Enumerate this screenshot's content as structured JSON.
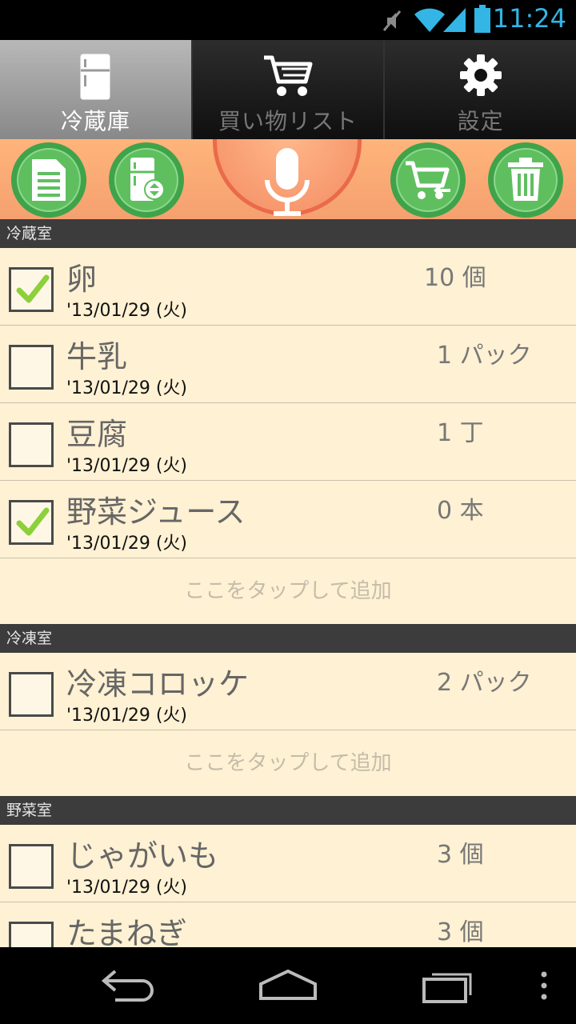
{
  "status_bar": {
    "time": "11:24",
    "icons": [
      "mute-icon",
      "wifi-icon",
      "signal-icon",
      "battery-icon"
    ]
  },
  "tabs": [
    {
      "label": "冷蔵庫",
      "icon": "fridge-icon",
      "active": true
    },
    {
      "label": "買い物リスト",
      "icon": "cart-icon",
      "active": false
    },
    {
      "label": "設定",
      "icon": "gear-icon",
      "active": false
    }
  ],
  "toolbar": {
    "buttons": [
      "document-icon",
      "fridge-sort-icon",
      "microphone-icon",
      "cart-move-icon",
      "trash-icon"
    ]
  },
  "sections": [
    {
      "title": "冷蔵室",
      "items": [
        {
          "name": "卵",
          "qty": "10 個",
          "date": "'13/01/29 (火)",
          "checked": true
        },
        {
          "name": "牛乳",
          "qty": "1 パック",
          "date": "'13/01/29 (火)",
          "checked": false
        },
        {
          "name": "豆腐",
          "qty": "1 丁",
          "date": "'13/01/29 (火)",
          "checked": false
        },
        {
          "name": "野菜ジュース",
          "qty": "0 本",
          "date": "'13/01/29 (火)",
          "checked": true
        }
      ],
      "add_label": "ここをタップして追加"
    },
    {
      "title": "冷凍室",
      "items": [
        {
          "name": "冷凍コロッケ",
          "qty": "2 パック",
          "date": "'13/01/29 (火)",
          "checked": false
        }
      ],
      "add_label": "ここをタップして追加"
    },
    {
      "title": "野菜室",
      "items": [
        {
          "name": "じゃがいも",
          "qty": "3 個",
          "date": "'13/01/29 (火)",
          "checked": false
        },
        {
          "name": "たまねぎ",
          "qty": "3 個",
          "date": "",
          "checked": false
        }
      ]
    }
  ],
  "colors": {
    "accent_blue": "#33b5e5",
    "toolbar_orange": "#f5a070",
    "button_green": "#5fbf5f",
    "list_bg": "#fff1d3",
    "section_bg": "#3c3c3c"
  }
}
